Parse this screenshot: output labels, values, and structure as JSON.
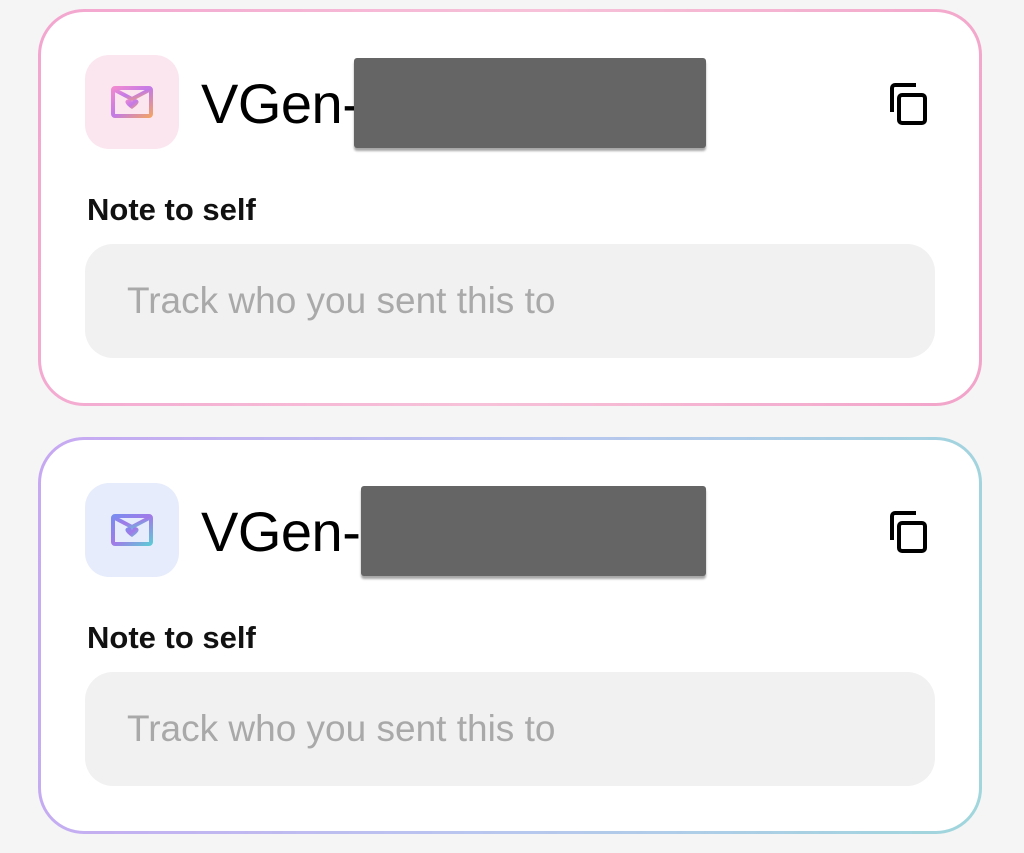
{
  "cards": [
    {
      "alias_prefix": "VGen-",
      "note_label": "Note to self",
      "note_placeholder": "Track who you sent this to",
      "note_value": "",
      "theme": "pink",
      "icon": "heart-mail-icon",
      "accent_colors": [
        "#f3a6cf",
        "#f7c2d9"
      ]
    },
    {
      "alias_prefix": "VGen-",
      "note_label": "Note to self",
      "note_placeholder": "Track who you sent this to",
      "note_value": "",
      "theme": "blue",
      "icon": "heart-mail-icon",
      "accent_colors": [
        "#c7a8f2",
        "#9fd6dc"
      ]
    }
  ],
  "copy_icon": "copy-icon",
  "background_color": "#f5f5f5"
}
